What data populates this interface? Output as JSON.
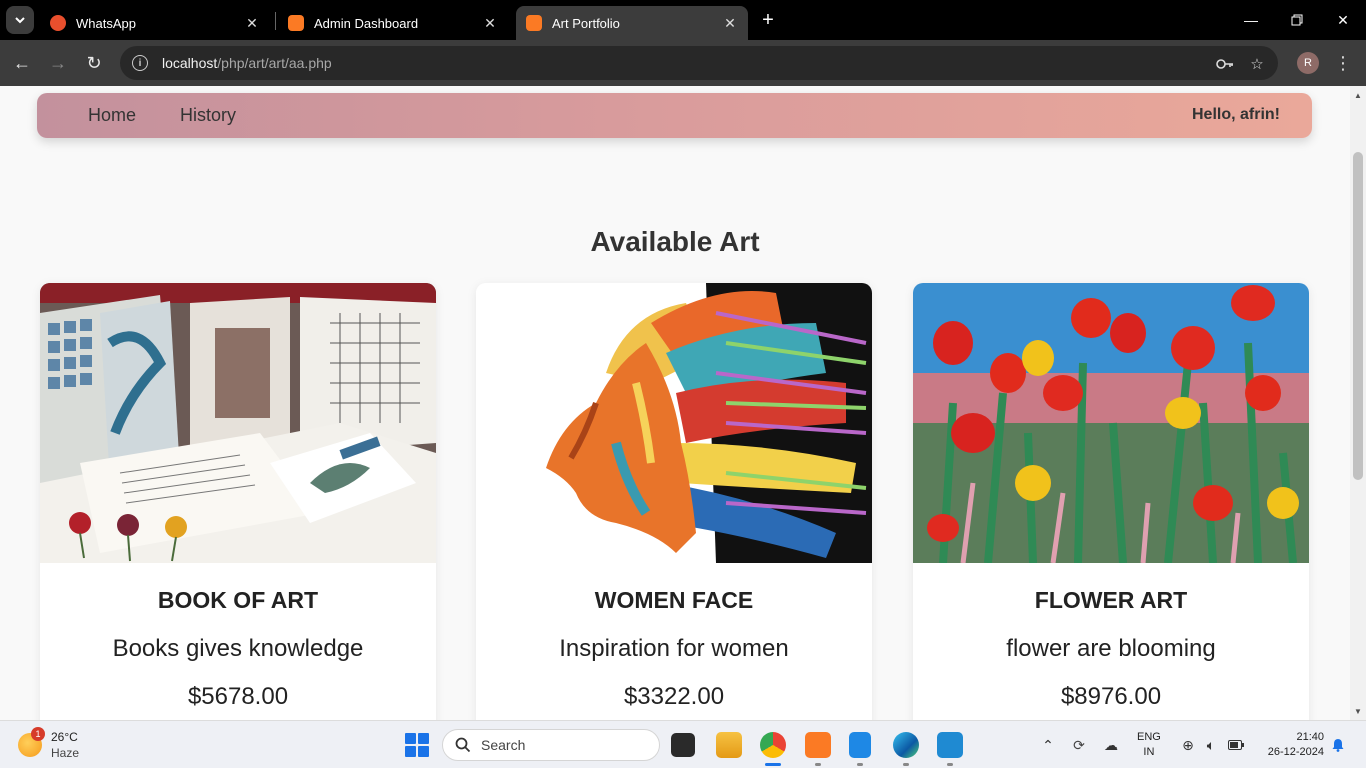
{
  "browser": {
    "tabs": [
      {
        "title": "WhatsApp",
        "favicon": "whatsapp-icon",
        "color": "#e94f2d"
      },
      {
        "title": "Admin Dashboard",
        "favicon": "xampp-icon",
        "color": "#fb7a24"
      },
      {
        "title": "Art Portfolio",
        "favicon": "xampp-icon",
        "color": "#fb7a24"
      }
    ],
    "url_host": "localhost",
    "url_path": "/php/art/art/aa.php",
    "profile_initial": "R"
  },
  "page": {
    "nav": {
      "home": "Home",
      "history": "History",
      "greeting": "Hello, afrin!"
    },
    "section_title": "Available Art",
    "cards": [
      {
        "name": "BOOK OF ART",
        "description": "Books gives knowledge",
        "price": "$5678.00",
        "image": "sketchbooks-photo"
      },
      {
        "name": "WOMEN FACE",
        "description": "Inspiration for women",
        "price": "$3322.00",
        "image": "colorful-face-profile"
      },
      {
        "name": "FLOWER ART",
        "description": "flower are blooming",
        "price": "$8976.00",
        "image": "tulip-painting"
      }
    ]
  },
  "taskbar": {
    "weather": {
      "temp": "26°C",
      "condition": "Haze",
      "badge": "1"
    },
    "search_placeholder": "Search",
    "lang_top": "ENG",
    "lang_bottom": "IN",
    "time": "21:40",
    "date": "26-12-2024"
  },
  "colors": {
    "navbar_start": "#c3919d",
    "navbar_end": "#eaa89a",
    "accent": "#1a73e8"
  }
}
